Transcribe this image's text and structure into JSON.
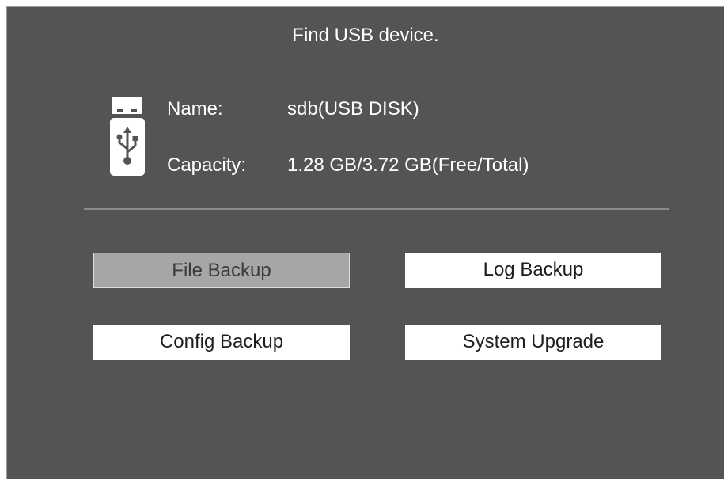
{
  "dialog": {
    "title": "Find USB device."
  },
  "device": {
    "icon": "usb-drive-icon",
    "name_label": "Name:",
    "name_value": "sdb(USB DISK)",
    "capacity_label": "Capacity:",
    "capacity_value": "1.28 GB/3.72 GB(Free/Total)"
  },
  "actions": {
    "file_backup": "File Backup",
    "log_backup": "Log Backup",
    "config_backup": "Config Backup",
    "system_upgrade": "System Upgrade",
    "selected": "file_backup"
  },
  "colors": {
    "panel_background": "#545454",
    "button_background": "#ffffff",
    "button_selected_background": "#a6a6a6",
    "divider": "#8c8c8c"
  }
}
